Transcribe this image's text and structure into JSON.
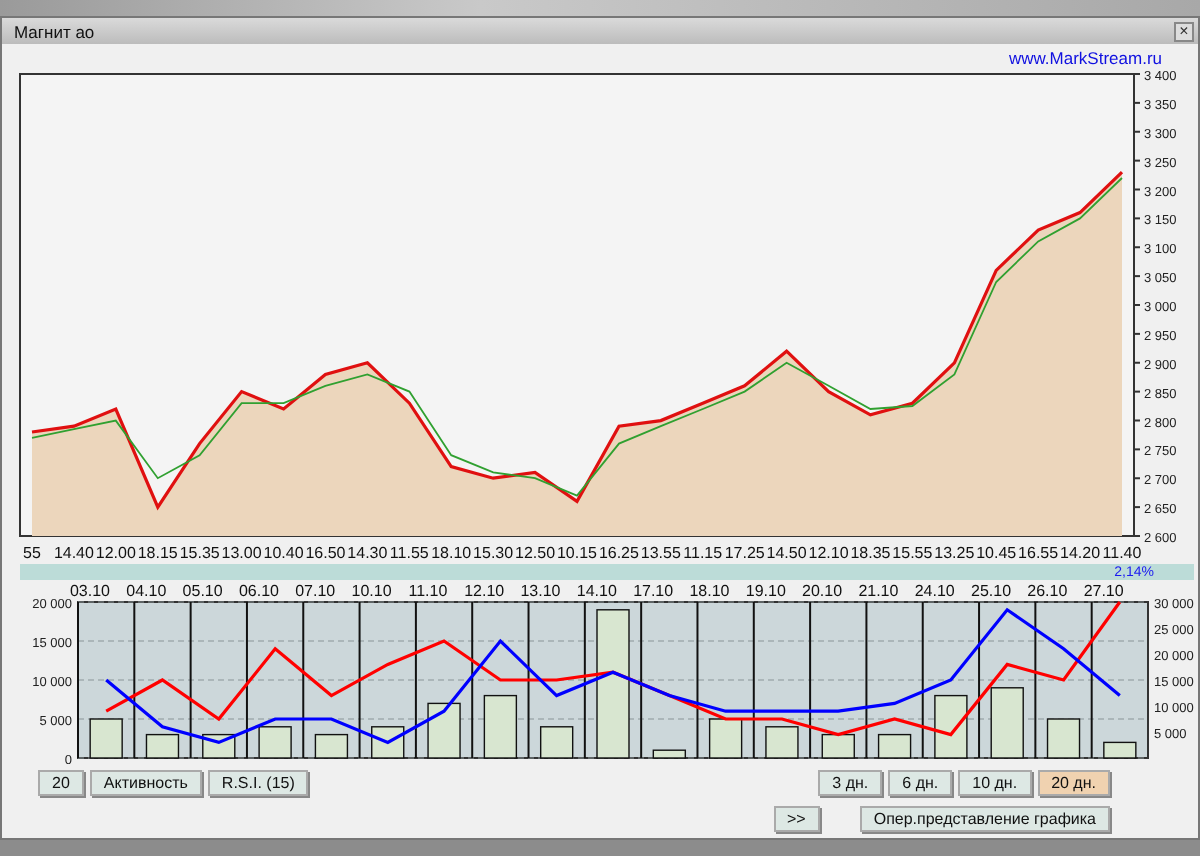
{
  "window": {
    "title": "Магнит ао",
    "close": "×"
  },
  "link": "www.MarkStream.ru",
  "price_chart": {
    "chart_data": {
      "type": "area",
      "categories": [
        "55",
        "14.40",
        "12.00",
        "18.15",
        "15.35",
        "13.00",
        "10.40",
        "16.50",
        "14.30",
        "11.55",
        "18.10",
        "15.30",
        "12.50",
        "10.15",
        "16.25",
        "13.55",
        "11.15",
        "17.25",
        "14.50",
        "12.10",
        "18.35",
        "15.55",
        "13.25",
        "10.45",
        "16.55",
        "14.20",
        "11.40"
      ],
      "series": [
        {
          "type": "area",
          "color": "#e01010",
          "values": [
            2780,
            2790,
            2820,
            2650,
            2760,
            2850,
            2820,
            2880,
            2900,
            2830,
            2720,
            2700,
            2710,
            2660,
            2790,
            2800,
            2830,
            2860,
            2920,
            2850,
            2810,
            2830,
            2900,
            3060,
            3130,
            3160,
            3230
          ]
        },
        {
          "type": "line",
          "color": "#30a030",
          "values": [
            2770,
            2785,
            2800,
            2700,
            2740,
            2830,
            2830,
            2860,
            2880,
            2850,
            2740,
            2710,
            2700,
            2670,
            2760,
            2790,
            2820,
            2850,
            2900,
            2860,
            2820,
            2825,
            2880,
            3040,
            3110,
            3150,
            3220
          ]
        }
      ],
      "ylim": [
        2600,
        3400
      ],
      "yticks": [
        {
          "value": 2600,
          "label": "2 600"
        },
        {
          "value": 2650,
          "label": "2 650"
        },
        {
          "value": 2700,
          "label": "2 700"
        },
        {
          "value": 2750,
          "label": "2 750"
        },
        {
          "value": 2800,
          "label": "2 800"
        },
        {
          "value": 2850,
          "label": "2 850"
        },
        {
          "value": 2900,
          "label": "2 900"
        },
        {
          "value": 2950,
          "label": "2 950"
        },
        {
          "value": 3000,
          "label": "3 000"
        },
        {
          "value": 3050,
          "label": "3 050"
        },
        {
          "value": 3100,
          "label": "3 100"
        },
        {
          "value": 3150,
          "label": "3 150"
        },
        {
          "value": 3200,
          "label": "3 200"
        },
        {
          "value": 3250,
          "label": "3 250"
        },
        {
          "value": 3300,
          "label": "3 300"
        },
        {
          "value": 3350,
          "label": "3 350"
        },
        {
          "value": 3400,
          "label": "3 400"
        }
      ]
    }
  },
  "change_bar": {
    "text": "2,14%"
  },
  "activity_chart": {
    "chart_data": {
      "type": "bar",
      "categories": [
        "03.10",
        "04.10",
        "05.10",
        "06.10",
        "07.10",
        "10.10",
        "11.10",
        "12.10",
        "13.10",
        "14.10",
        "17.10",
        "18.10",
        "19.10",
        "20.10",
        "21.10",
        "24.10",
        "25.10",
        "26.10",
        "27.10"
      ],
      "series": [
        {
          "type": "bar",
          "color": "#d8e6d0",
          "values": [
            5000,
            3000,
            3000,
            4000,
            3000,
            4000,
            7000,
            8000,
            4000,
            19000,
            1000,
            5000,
            4000,
            3000,
            3000,
            8000,
            9000,
            5000,
            2000
          ]
        },
        {
          "type": "line",
          "color": "#ff0000",
          "values": [
            6000,
            10000,
            5000,
            14000,
            8000,
            12000,
            15000,
            10000,
            10000,
            11000,
            8000,
            5000,
            5000,
            3000,
            5000,
            3000,
            12000,
            10000,
            20000
          ]
        },
        {
          "type": "line",
          "color": "#0000ff",
          "values": [
            10000,
            4000,
            2000,
            5000,
            5000,
            2000,
            6000,
            15000,
            8000,
            11000,
            8000,
            6000,
            6000,
            6000,
            7000,
            10000,
            19000,
            14000,
            8000
          ]
        }
      ],
      "ylim": [
        0,
        20000
      ],
      "y2lim": [
        0,
        30000
      ],
      "grid": true,
      "yticks": [
        {
          "value": 0,
          "label": "0"
        },
        {
          "value": 5000,
          "label": "5 000"
        },
        {
          "value": 10000,
          "label": "10 000"
        },
        {
          "value": 15000,
          "label": "15 000"
        },
        {
          "value": 20000,
          "label": "20 000"
        }
      ],
      "y2ticks": [
        {
          "value": 5000,
          "label": "5 000"
        },
        {
          "value": 10000,
          "label": "10 000"
        },
        {
          "value": 15000,
          "label": "15 000"
        },
        {
          "value": 20000,
          "label": "20 000"
        },
        {
          "value": 25000,
          "label": "25 000"
        },
        {
          "value": 30000,
          "label": "30 000"
        }
      ]
    }
  },
  "left_buttons": [
    "20",
    "Активность",
    "R.S.I.  (15)"
  ],
  "period_buttons": [
    {
      "label": "3 дн.",
      "selected": false
    },
    {
      "label": "6 дн.",
      "selected": false
    },
    {
      "label": "10 дн.",
      "selected": false
    },
    {
      "label": "20 дн.",
      "selected": true
    }
  ],
  "scroll_button": ">>",
  "view_button": "Опер.представление графика"
}
